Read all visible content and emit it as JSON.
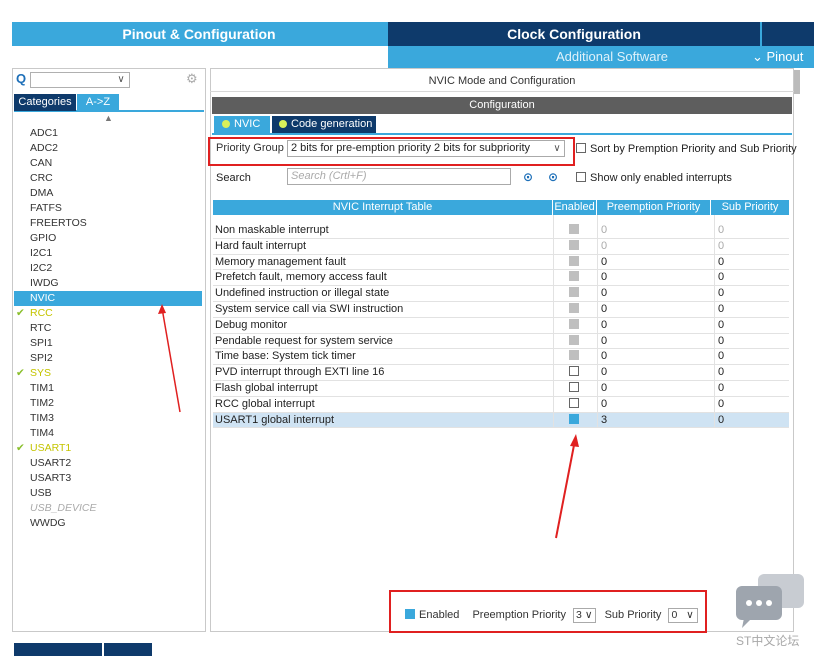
{
  "header": {
    "tabs": [
      "Pinout & Configuration",
      "Clock Configuration"
    ],
    "subtabs": [
      "Additional Software",
      "Pinout"
    ]
  },
  "left": {
    "category_tabs": [
      "Categories",
      "A->Z"
    ],
    "peripherals": [
      {
        "label": "ADC1",
        "state": "normal"
      },
      {
        "label": "ADC2",
        "state": "normal"
      },
      {
        "label": "CAN",
        "state": "normal"
      },
      {
        "label": "CRC",
        "state": "normal"
      },
      {
        "label": "DMA",
        "state": "normal"
      },
      {
        "label": "FATFS",
        "state": "normal"
      },
      {
        "label": "FREERTOS",
        "state": "normal"
      },
      {
        "label": "GPIO",
        "state": "normal"
      },
      {
        "label": "I2C1",
        "state": "normal"
      },
      {
        "label": "I2C2",
        "state": "normal"
      },
      {
        "label": "IWDG",
        "state": "normal"
      },
      {
        "label": "NVIC",
        "state": "selected"
      },
      {
        "label": "RCC",
        "state": "configured"
      },
      {
        "label": "RTC",
        "state": "normal"
      },
      {
        "label": "SPI1",
        "state": "normal"
      },
      {
        "label": "SPI2",
        "state": "normal"
      },
      {
        "label": "SYS",
        "state": "configured"
      },
      {
        "label": "TIM1",
        "state": "normal"
      },
      {
        "label": "TIM2",
        "state": "normal"
      },
      {
        "label": "TIM3",
        "state": "normal"
      },
      {
        "label": "TIM4",
        "state": "normal"
      },
      {
        "label": "USART1",
        "state": "configured"
      },
      {
        "label": "USART2",
        "state": "normal"
      },
      {
        "label": "USART3",
        "state": "normal"
      },
      {
        "label": "USB",
        "state": "normal"
      },
      {
        "label": "USB_DEVICE",
        "state": "disabled"
      },
      {
        "label": "WWDG",
        "state": "normal"
      }
    ]
  },
  "right": {
    "title": "NVIC Mode and Configuration",
    "config_label": "Configuration",
    "tabs": [
      "NVIC",
      "Code generation"
    ],
    "priority_group_label": "Priority Group",
    "priority_group_value": "2 bits for pre-emption priority 2 bits for subpriority",
    "sort_label": "Sort by Premption Priority and Sub Priority",
    "search_label": "Search",
    "search_placeholder": "Search (Crtl+F)",
    "show_enabled_label": "Show only enabled interrupts",
    "table": {
      "columns": [
        "NVIC Interrupt Table",
        "Enabled",
        "Preemption Priority",
        "Sub Priority"
      ],
      "rows": [
        {
          "name": "Non maskable interrupt",
          "enabled": "locked",
          "pp": "0",
          "sp": "0",
          "grey": true
        },
        {
          "name": "Hard fault interrupt",
          "enabled": "locked",
          "pp": "0",
          "sp": "0",
          "grey": true
        },
        {
          "name": "Memory management fault",
          "enabled": "locked",
          "pp": "0",
          "sp": "0",
          "grey": false
        },
        {
          "name": "Prefetch fault, memory access fault",
          "enabled": "locked",
          "pp": "0",
          "sp": "0",
          "grey": false
        },
        {
          "name": "Undefined instruction or illegal state",
          "enabled": "locked",
          "pp": "0",
          "sp": "0",
          "grey": false
        },
        {
          "name": "System service call via SWI instruction",
          "enabled": "locked",
          "pp": "0",
          "sp": "0",
          "grey": false
        },
        {
          "name": "Debug monitor",
          "enabled": "locked",
          "pp": "0",
          "sp": "0",
          "grey": false
        },
        {
          "name": "Pendable request for system service",
          "enabled": "locked",
          "pp": "0",
          "sp": "0",
          "grey": false
        },
        {
          "name": "Time base: System tick timer",
          "enabled": "locked",
          "pp": "0",
          "sp": "0",
          "grey": false
        },
        {
          "name": "PVD interrupt through EXTI line 16",
          "enabled": "off",
          "pp": "0",
          "sp": "0",
          "grey": false
        },
        {
          "name": "Flash global interrupt",
          "enabled": "off",
          "pp": "0",
          "sp": "0",
          "grey": false
        },
        {
          "name": "RCC global interrupt",
          "enabled": "off",
          "pp": "0",
          "sp": "0",
          "grey": false
        },
        {
          "name": "USART1 global interrupt",
          "enabled": "on",
          "pp": "3",
          "sp": "0",
          "grey": false
        }
      ]
    },
    "bottom": {
      "enabled_label": "Enabled",
      "pp_label": "Preemption Priority",
      "pp_value": "3",
      "sp_label": "Sub Priority",
      "sp_value": "0"
    }
  },
  "watermark": "ST中文论坛",
  "colors": {
    "accent": "#3aa8dc",
    "dark": "#0e3a6b",
    "annotation": "#e02020"
  }
}
